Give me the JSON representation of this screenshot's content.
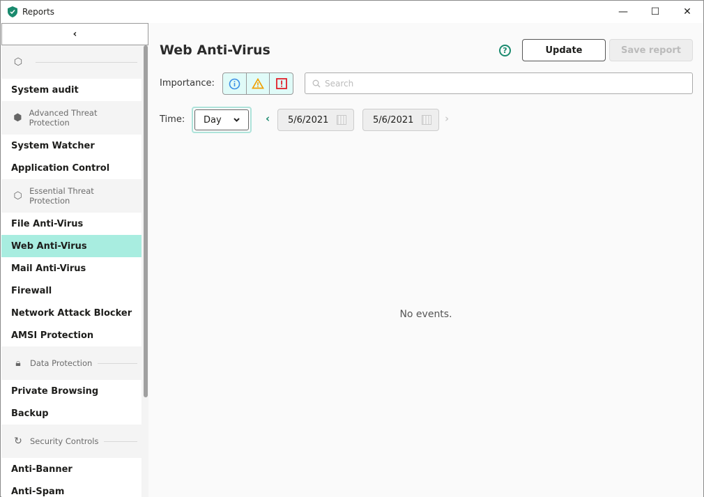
{
  "window": {
    "title": "Reports",
    "minimize": "—",
    "maximize": "☐",
    "close": "✕"
  },
  "sidebar": {
    "collapse_icon": "‹",
    "groups": [
      {
        "label": "",
        "icon": "shield-icon",
        "items": [
          "System audit"
        ]
      },
      {
        "label": "Advanced Threat Protection",
        "icon": "shield-advanced-icon",
        "items": [
          "System Watcher",
          "Application Control"
        ]
      },
      {
        "label": "Essential Threat Protection",
        "icon": "shield-icon",
        "items": [
          "File Anti-Virus",
          "Web Anti-Virus",
          "Mail Anti-Virus",
          "Firewall",
          "Network Attack Blocker",
          "AMSI Protection"
        ]
      },
      {
        "label": "Data Protection",
        "icon": "lock-icon",
        "items": [
          "Private Browsing",
          "Backup"
        ]
      },
      {
        "label": "Security Controls",
        "icon": "security-controls-icon",
        "items": [
          "Anti-Banner",
          "Anti-Spam"
        ]
      }
    ],
    "selected": "Web Anti-Virus"
  },
  "main": {
    "title": "Web Anti-Virus",
    "help": "?",
    "update_label": "Update",
    "save_label": "Save report",
    "importance_label": "Importance:",
    "search_placeholder": "Search",
    "time_label": "Time:",
    "period": "Day",
    "date_from": "5/6/2021",
    "date_to": "5/6/2021",
    "empty": "No events.",
    "colors": {
      "accent": "#1a8a6e",
      "selected": "#a8ede0",
      "info": "#3a8ee6",
      "warning": "#f0a000",
      "critical": "#e0202a"
    }
  }
}
